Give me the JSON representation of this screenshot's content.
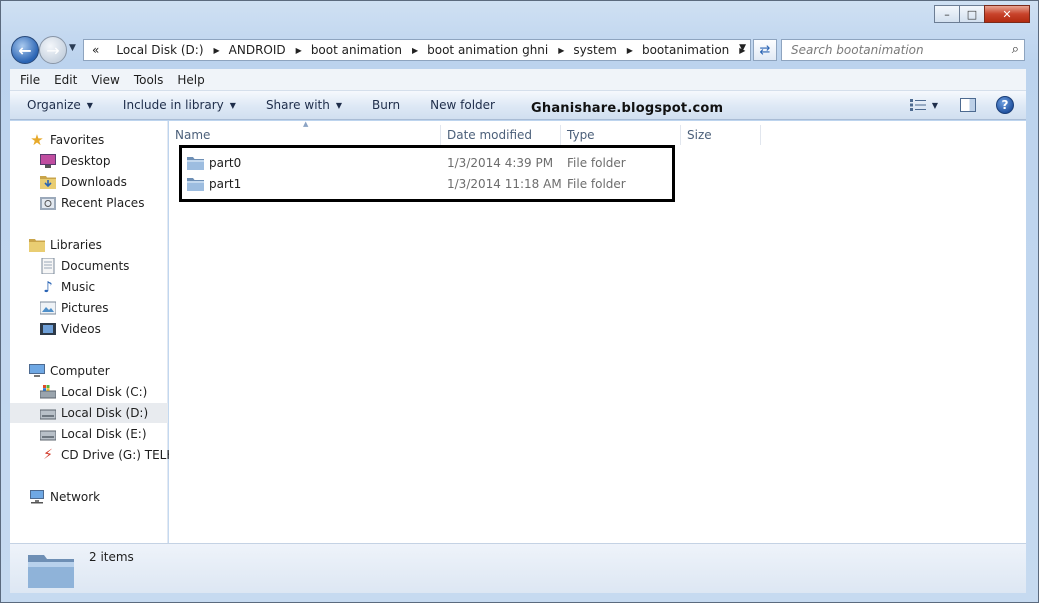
{
  "window": {
    "caption_buttons": [
      "minimize",
      "maximize",
      "close"
    ]
  },
  "address": {
    "overflow": "«",
    "crumbs": [
      "Local Disk (D:)",
      "ANDROID",
      "boot animation",
      "boot animation ghni",
      "system",
      "bootanimation"
    ]
  },
  "search": {
    "placeholder": "Search bootanimation"
  },
  "menu": [
    "File",
    "Edit",
    "View",
    "Tools",
    "Help"
  ],
  "commands": {
    "organize": "Organize",
    "include_in_library": "Include in library",
    "share_with": "Share with",
    "burn": "Burn",
    "new_folder": "New folder"
  },
  "watermark": "Ghanishare.blogspot.com",
  "nav": {
    "favorites": {
      "label": "Favorites",
      "items": [
        "Desktop",
        "Downloads",
        "Recent Places"
      ]
    },
    "libraries": {
      "label": "Libraries",
      "items": [
        "Documents",
        "Music",
        "Pictures",
        "Videos"
      ]
    },
    "computer": {
      "label": "Computer",
      "items": [
        "Local Disk (C:)",
        "Local Disk (D:)",
        "Local Disk (E:)",
        "CD Drive (G:) TELKO"
      ],
      "selected": "Local Disk (D:)"
    },
    "network": {
      "label": "Network"
    }
  },
  "columns": [
    "Name",
    "Date modified",
    "Type",
    "Size"
  ],
  "files": [
    {
      "name": "part0",
      "date": "1/3/2014 4:39 PM",
      "type": "File folder",
      "size": ""
    },
    {
      "name": "part1",
      "date": "1/3/2014 11:18 AM",
      "type": "File folder",
      "size": ""
    }
  ],
  "status": {
    "count": "2 items"
  },
  "colors": {
    "accent": "#2a64b4",
    "folder": "#8fb3d9",
    "highlight_box": "#000000"
  }
}
